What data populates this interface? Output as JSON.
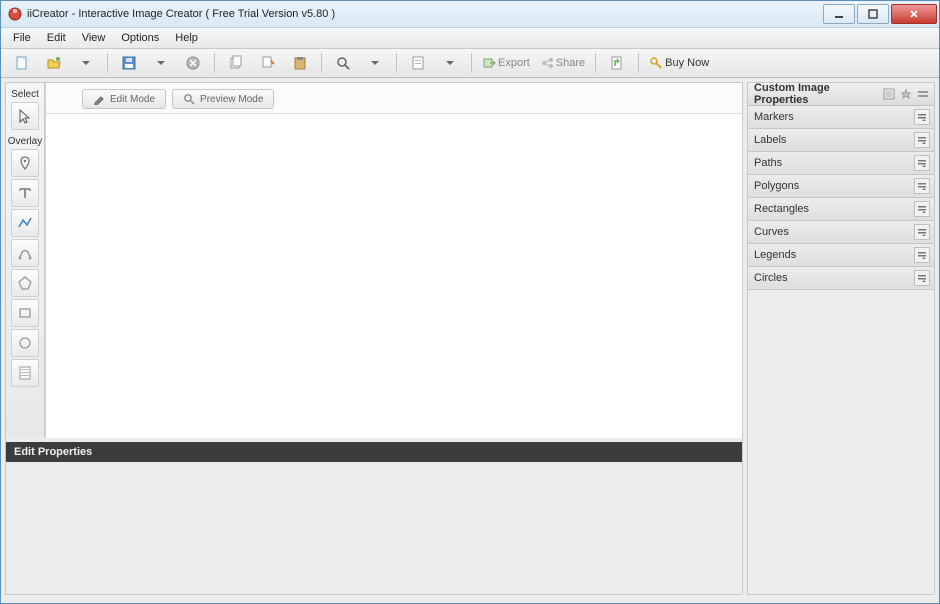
{
  "title": "iiCreator - Interactive Image Creator ( Free Trial Version v5.80 )",
  "menu": {
    "file": "File",
    "edit": "Edit",
    "view": "View",
    "options": "Options",
    "help": "Help"
  },
  "toolbar": {
    "export": "Export",
    "share": "Share",
    "buynow": "Buy Now"
  },
  "modes": {
    "edit": "Edit Mode",
    "preview": "Preview Mode"
  },
  "toolstrip": {
    "select": "Select",
    "overlay": "Overlay"
  },
  "editprops": {
    "title": "Edit Properties"
  },
  "right": {
    "header": "Custom Image Properties",
    "sections": [
      {
        "label": "Markers"
      },
      {
        "label": "Labels"
      },
      {
        "label": "Paths"
      },
      {
        "label": "Polygons"
      },
      {
        "label": "Rectangles"
      },
      {
        "label": "Curves"
      },
      {
        "label": "Legends"
      },
      {
        "label": "Circles"
      }
    ]
  }
}
